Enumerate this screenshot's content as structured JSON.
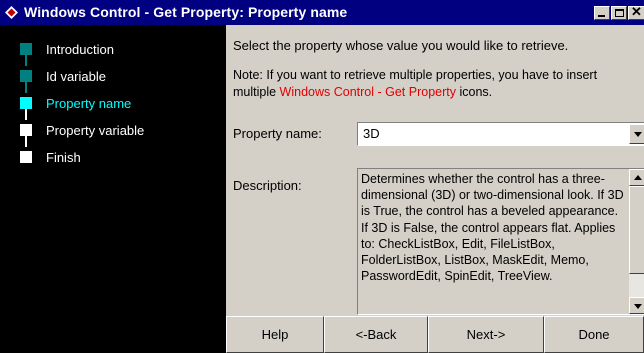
{
  "window": {
    "title": "Windows Control - Get Property: Property name",
    "icon": "diamond-icon",
    "controls": [
      "minimize-icon",
      "maximize-icon",
      "close-icon"
    ]
  },
  "steps": [
    {
      "label": "Introduction",
      "state": "done",
      "color": "#008080"
    },
    {
      "label": "Id variable",
      "state": "done",
      "color": "#008080"
    },
    {
      "label": "Property name",
      "state": "current",
      "color": "#00ffff"
    },
    {
      "label": "Property variable",
      "state": "pending",
      "color": "#ffffff"
    },
    {
      "label": "Finish",
      "state": "pending",
      "color": "#ffffff"
    }
  ],
  "content": {
    "intro": "Select the property whose value you would like to retrieve.",
    "note_before": "Note: If you want to retrieve multiple properties, you have to insert multiple ",
    "note_highlight": "Windows Control - Get Property",
    "note_after": " icons.",
    "property_label": "Property name:",
    "property_value": "3D",
    "description_label": "Description:",
    "description": "Determines whether the control has a three-dimensional (3D) or two-dimensional look. If 3D is True, the control has a beveled appearance. If 3D is False, the control appears flat. Applies to: CheckListBox, Edit, FileListBox, FolderListBox, ListBox, MaskEdit, Memo, PasswordEdit, SpinEdit, TreeView."
  },
  "buttons": {
    "help": "Help",
    "back": "<-Back",
    "next": "Next->",
    "done": "Done"
  },
  "colors": {
    "titlebar": "#000080",
    "sidebar": "#000000",
    "face": "#d4d0c8",
    "highlight_text": "#e00000"
  }
}
